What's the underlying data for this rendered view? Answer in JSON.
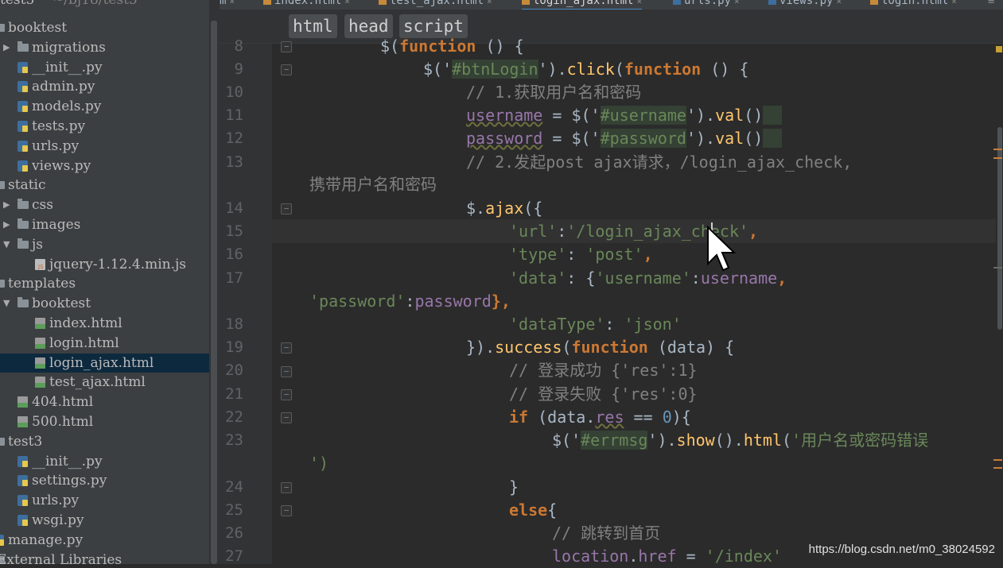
{
  "tabs": [
    {
      "label": "m",
      "active": false
    },
    {
      "label": "index.html",
      "active": false
    },
    {
      "label": "test_ajax.html",
      "active": false
    },
    {
      "label": "login_ajax.html",
      "active": true
    },
    {
      "label": "urls.py",
      "active": false
    },
    {
      "label": "views.py",
      "active": false
    },
    {
      "label": "login.html",
      "active": false
    }
  ],
  "tree": {
    "project_label": "test5",
    "project_path": "~/bj18/test5",
    "items": [
      {
        "label": "booktest",
        "type": "folder",
        "depth": 0,
        "expanded": true
      },
      {
        "label": "migrations",
        "type": "folder",
        "depth": 1,
        "expanded": false
      },
      {
        "label": "__init__.py",
        "type": "py",
        "depth": 1
      },
      {
        "label": "admin.py",
        "type": "py",
        "depth": 1
      },
      {
        "label": "models.py",
        "type": "py",
        "depth": 1
      },
      {
        "label": "tests.py",
        "type": "py",
        "depth": 1
      },
      {
        "label": "urls.py",
        "type": "py",
        "depth": 1
      },
      {
        "label": "views.py",
        "type": "py",
        "depth": 1
      },
      {
        "label": "static",
        "type": "folder",
        "depth": 0,
        "expanded": true
      },
      {
        "label": "css",
        "type": "folder",
        "depth": 1
      },
      {
        "label": "images",
        "type": "folder",
        "depth": 1
      },
      {
        "label": "js",
        "type": "folder",
        "depth": 1,
        "expanded": true
      },
      {
        "label": "jquery-1.12.4.min.js",
        "type": "js",
        "depth": 2
      },
      {
        "label": "templates",
        "type": "folder",
        "depth": 0,
        "expanded": true
      },
      {
        "label": "booktest",
        "type": "folder",
        "depth": 1,
        "expanded": true
      },
      {
        "label": "index.html",
        "type": "html",
        "depth": 2
      },
      {
        "label": "login.html",
        "type": "html",
        "depth": 2
      },
      {
        "label": "login_ajax.html",
        "type": "html",
        "depth": 2,
        "selected": true
      },
      {
        "label": "test_ajax.html",
        "type": "html",
        "depth": 2
      },
      {
        "label": "404.html",
        "type": "html",
        "depth": 1
      },
      {
        "label": "500.html",
        "type": "html",
        "depth": 1
      },
      {
        "label": "test3",
        "type": "folder",
        "depth": 0,
        "expanded": true
      },
      {
        "label": "__init__.py",
        "type": "py",
        "depth": 1
      },
      {
        "label": "settings.py",
        "type": "py",
        "depth": 1
      },
      {
        "label": "urls.py",
        "type": "py",
        "depth": 1
      },
      {
        "label": "wsgi.py",
        "type": "py",
        "depth": 1
      },
      {
        "label": "manage.py",
        "type": "py",
        "depth": 0
      },
      {
        "label": "External Libraries",
        "type": "lib",
        "depth": 0
      }
    ]
  },
  "breadcrumb": [
    "html",
    "head",
    "script"
  ],
  "line_numbers": [
    "8",
    "9",
    "10",
    "11",
    "12",
    "13",
    "14",
    "15",
    "16",
    "17",
    "18",
    "19",
    "20",
    "21",
    "22",
    "23",
    "24",
    "25",
    "26",
    "27"
  ],
  "code": {
    "l8": [
      "$(",
      "function",
      " () {"
    ],
    "l9": [
      "$('",
      "#btnLogin",
      "').",
      "click",
      "(",
      "function",
      " () {"
    ],
    "l10": "// 1.获取用户名和密码",
    "l11": [
      "username",
      " = $('",
      "#username",
      "').",
      "val",
      "()"
    ],
    "l12": [
      "password",
      " = $('",
      "#password",
      "').",
      "val",
      "()"
    ],
    "l13a": "// 2.发起post ajax请求，/login_ajax_check,",
    "l13b": "携带用户名和密码",
    "l14": [
      "$.",
      "ajax",
      "({"
    ],
    "l15": [
      "'url'",
      ":",
      "'/login_ajax_check'",
      ","
    ],
    "l16": [
      "'type'",
      ": ",
      "'post'",
      ","
    ],
    "l17a": [
      "'data'",
      ": {",
      "'username'",
      ":",
      "username",
      ","
    ],
    "l17b": [
      "'password'",
      ":",
      "password",
      "},"
    ],
    "l18": [
      "'dataType'",
      ": ",
      "'json'"
    ],
    "l19": [
      "}).",
      "success",
      "(",
      "function",
      " (data) {"
    ],
    "l20": "// 登录成功 {'res':1}",
    "l21": "// 登录失败 {'res':0}",
    "l22": [
      "if",
      " (data.",
      "res",
      " == ",
      "0",
      "){"
    ],
    "l23a": [
      "$('",
      "#errmsg",
      "').",
      "show",
      "().",
      "html",
      "(",
      "'用户名或密码错误"
    ],
    "l23b": "')",
    "l24": "}",
    "l25": [
      "else",
      "{"
    ],
    "l26": "// 跳转到首页",
    "l27": [
      "location",
      ".",
      "href",
      " = ",
      "'/index'"
    ]
  },
  "watermark": "https://blog.csdn.net/m0_38024592"
}
